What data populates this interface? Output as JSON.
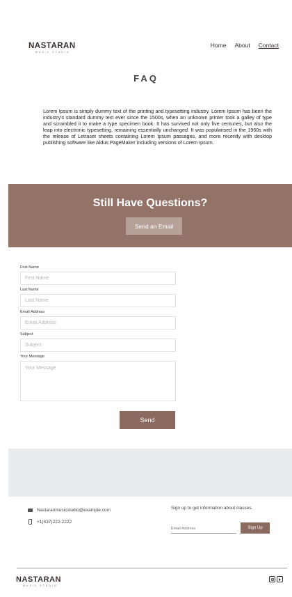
{
  "brand": {
    "name": "NASTARAN",
    "tagline": "MUSIC STUDIO"
  },
  "nav": {
    "items": [
      "Home",
      "About",
      "Contact"
    ],
    "active": "Contact"
  },
  "faq": {
    "title": "FAQ",
    "body": "Lorem Ipsum is simply dummy text of the printing and typesetting industry. Lorem Ipsum has been the industry's standard dummy text ever since the 1500s, when an unknown printer took a galley of type and scrambled it to make a type specimen book. It has survived not only five centuries, but also the leap into electronic typesetting, remaining essentially unchanged. It was popularised in the 1960s with the release of Letraset sheets containing Lorem Ipsum passages, and more recently with desktop publishing software like Aldus PageMaker including versions of Lorem Ipsum."
  },
  "questions": {
    "title": "Still Have Questions?",
    "button": "Send an Email"
  },
  "form": {
    "first_name": {
      "label": "First Name",
      "placeholder": "First Name"
    },
    "last_name": {
      "label": "Last Name",
      "placeholder": "Last Name"
    },
    "email": {
      "label": "Email Address",
      "placeholder": "Email Address"
    },
    "subject": {
      "label": "Subject",
      "placeholder": "Subject"
    },
    "message": {
      "label": "Your Message",
      "placeholder": "Your Message"
    },
    "submit": "Send"
  },
  "footer": {
    "email": "Nastaranmusicstudio@example.com",
    "phone": "+1(437)222-2222",
    "signup_text": "Sign up to get information about classes.",
    "signup_placeholder": "Email Address",
    "signup_button": "Sign Up",
    "icons": [
      "mail-icon",
      "phone-icon",
      "instagram-icon",
      "youtube-icon"
    ]
  },
  "colors": {
    "accent": "#937267",
    "button": "#8b6b60",
    "button_light": "#b8a199",
    "grey_band": "#e9ecee"
  }
}
